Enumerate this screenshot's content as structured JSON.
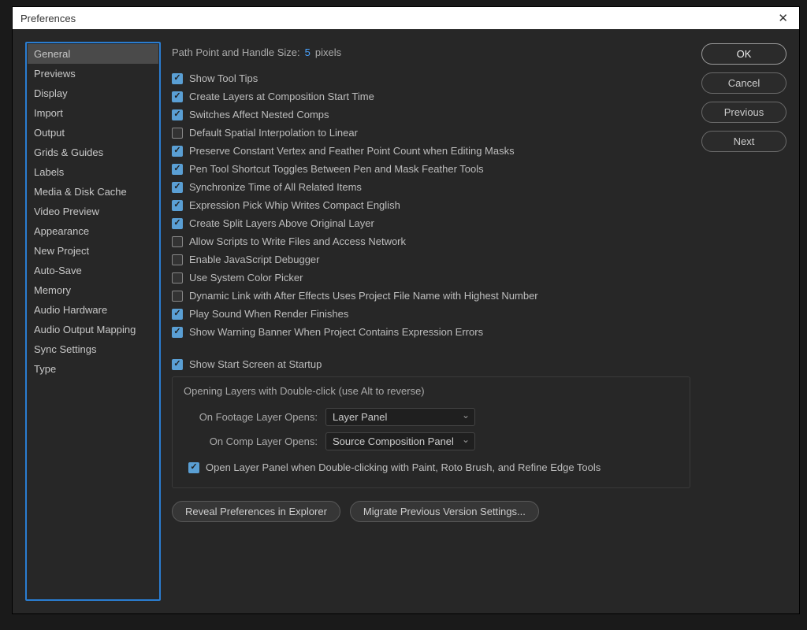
{
  "title": "Preferences",
  "sidebar": {
    "items": [
      {
        "label": "General",
        "selected": true
      },
      {
        "label": "Previews"
      },
      {
        "label": "Display"
      },
      {
        "label": "Import"
      },
      {
        "label": "Output"
      },
      {
        "label": "Grids & Guides"
      },
      {
        "label": "Labels"
      },
      {
        "label": "Media & Disk Cache"
      },
      {
        "label": "Video Preview"
      },
      {
        "label": "Appearance"
      },
      {
        "label": "New Project"
      },
      {
        "label": "Auto-Save"
      },
      {
        "label": "Memory"
      },
      {
        "label": "Audio Hardware"
      },
      {
        "label": "Audio Output Mapping"
      },
      {
        "label": "Sync Settings"
      },
      {
        "label": "Type"
      }
    ]
  },
  "path_row": {
    "label": "Path Point and Handle Size:",
    "value": "5",
    "unit": "pixels"
  },
  "checks": [
    {
      "label": "Show Tool Tips",
      "checked": true
    },
    {
      "label": "Create Layers at Composition Start Time",
      "checked": true
    },
    {
      "label": "Switches Affect Nested Comps",
      "checked": true
    },
    {
      "label": "Default Spatial Interpolation to Linear",
      "checked": false
    },
    {
      "label": "Preserve Constant Vertex and Feather Point Count when Editing Masks",
      "checked": true
    },
    {
      "label": "Pen Tool Shortcut Toggles Between Pen and Mask Feather Tools",
      "checked": true
    },
    {
      "label": "Synchronize Time of All Related Items",
      "checked": true
    },
    {
      "label": "Expression Pick Whip Writes Compact English",
      "checked": true
    },
    {
      "label": "Create Split Layers Above Original Layer",
      "checked": true
    },
    {
      "label": "Allow Scripts to Write Files and Access Network",
      "checked": false
    },
    {
      "label": "Enable JavaScript Debugger",
      "checked": false
    },
    {
      "label": "Use System Color Picker",
      "checked": false
    },
    {
      "label": "Dynamic Link with After Effects Uses Project File Name with Highest Number",
      "checked": false
    },
    {
      "label": "Play Sound When Render Finishes",
      "checked": true
    },
    {
      "label": "Show Warning Banner When Project Contains Expression Errors",
      "checked": true
    }
  ],
  "startup_check": {
    "label": "Show Start Screen at Startup",
    "checked": true
  },
  "fieldset": {
    "legend": "Opening Layers with Double-click (use Alt to reverse)",
    "row1_label": "On Footage Layer Opens:",
    "row1_value": "Layer Panel",
    "row2_label": "On Comp Layer Opens:",
    "row2_value": "Source Composition Panel",
    "inner_check": {
      "label": "Open Layer Panel when Double-clicking with Paint, Roto Brush, and Refine Edge Tools",
      "checked": true
    }
  },
  "bottom_buttons": {
    "reveal": "Reveal Preferences in Explorer",
    "migrate": "Migrate Previous Version Settings..."
  },
  "right_buttons": {
    "ok": "OK",
    "cancel": "Cancel",
    "previous": "Previous",
    "next": "Next"
  }
}
